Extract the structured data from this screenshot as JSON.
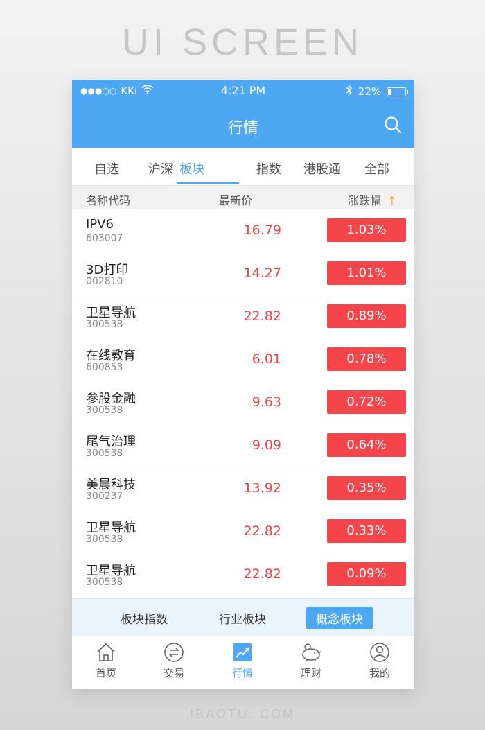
{
  "banner": "UI SCREEN",
  "footer": "IBAOTU. COM",
  "status": {
    "signal": "●●●○○",
    "carrier": "KKi",
    "time": "4:21 PM",
    "battery": "22%"
  },
  "navbar": {
    "title": "行情"
  },
  "tabs": [
    {
      "label": "自选"
    },
    {
      "label": "沪深"
    },
    {
      "label": "板块"
    },
    {
      "label": "指数"
    },
    {
      "label": "港股通"
    },
    {
      "label": "全部"
    }
  ],
  "table": {
    "headers": {
      "name": "名称代码",
      "price": "最新价",
      "change": "涨跌幅"
    },
    "sort_arrow": "↑",
    "rows": [
      {
        "name": "IPV6",
        "code": "603007",
        "price": "16.79",
        "change": "1.03%"
      },
      {
        "name": "3D打印",
        "code": "002810",
        "price": "14.27",
        "change": "1.01%"
      },
      {
        "name": "卫星导航",
        "code": "300538",
        "price": "22.82",
        "change": "0.89%"
      },
      {
        "name": "在线教育",
        "code": "600853",
        "price": "6.01",
        "change": "0.78%"
      },
      {
        "name": "参股金融",
        "code": "300538",
        "price": "9.63",
        "change": "0.72%"
      },
      {
        "name": "尾气治理",
        "code": "300538",
        "price": "9.09",
        "change": "0.64%"
      },
      {
        "name": "美晨科技",
        "code": "300237",
        "price": "13.92",
        "change": "0.35%"
      },
      {
        "name": "卫星导航",
        "code": "300538",
        "price": "22.82",
        "change": "0.33%"
      },
      {
        "name": "卫星导航",
        "code": "300538",
        "price": "22.82",
        "change": "0.09%"
      }
    ]
  },
  "subbar": [
    "板块指数",
    "行业板块",
    "概念板块"
  ],
  "tabbar": [
    {
      "label": "首页",
      "icon": "home-icon"
    },
    {
      "label": "交易",
      "icon": "exchange-icon"
    },
    {
      "label": "行情",
      "icon": "trend-icon"
    },
    {
      "label": "理财",
      "icon": "piggy-bank-icon"
    },
    {
      "label": "我的",
      "icon": "user-icon"
    }
  ],
  "colors": {
    "primary": "#4da7f3",
    "rise": "#f4464a",
    "sort_arrow": "#f5a623"
  }
}
